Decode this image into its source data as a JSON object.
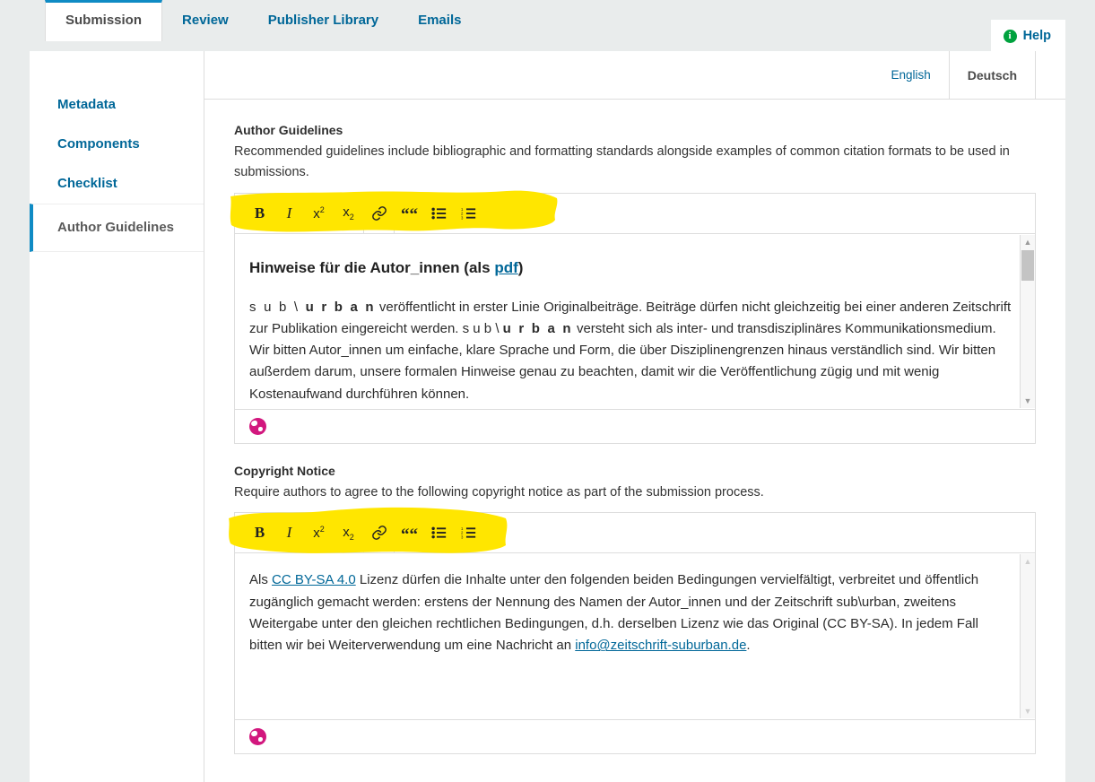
{
  "header": {
    "tabs": [
      {
        "label": "Submission",
        "active": true
      },
      {
        "label": "Review",
        "active": false
      },
      {
        "label": "Publisher Library",
        "active": false
      },
      {
        "label": "Emails",
        "active": false
      }
    ],
    "help_label": "Help",
    "help_icon": "info-icon"
  },
  "sidebar": {
    "items": [
      {
        "label": "Metadata",
        "active": false
      },
      {
        "label": "Components",
        "active": false
      },
      {
        "label": "Checklist",
        "active": false
      },
      {
        "label": "Author Guidelines",
        "active": true
      }
    ]
  },
  "language_tabs": [
    {
      "label": "English",
      "active": false
    },
    {
      "label": "Deutsch",
      "active": true
    }
  ],
  "toolbar": {
    "buttons": [
      {
        "name": "bold-button",
        "glyph": "B"
      },
      {
        "name": "italic-button",
        "glyph": "I"
      },
      {
        "name": "superscript-button",
        "glyph": "x",
        "script": "2"
      },
      {
        "name": "subscript-button",
        "glyph": "x",
        "script": "2"
      },
      {
        "name": "link-icon",
        "glyph": "link"
      },
      {
        "name": "blockquote-button",
        "glyph": "“"
      },
      {
        "name": "bullet-list-button",
        "glyph": "list"
      },
      {
        "name": "numbered-list-button",
        "glyph": "ordered-list"
      }
    ],
    "highlight_color": "#FFE600"
  },
  "fields": {
    "author_guidelines": {
      "label": "Author Guidelines",
      "description": "Recommended guidelines include bibliographic and formatting standards alongside examples of common citation formats to be used in submissions.",
      "heading_prefix": "Hinweise für die Autor_innen (als ",
      "heading_link": "pdf",
      "heading_suffix": ")",
      "body": {
        "l1a": "s u b \\ ",
        "l1b": "u r b a n",
        "l1c": " veröffentlicht in erster Linie Originalbeiträge. Beiträge dürfen nicht gleichzeitig bei einer anderen Zeitschrift zur Publikation eingereicht werden. s u b \\ ",
        "l2b": "u r b a n",
        "l2c": " versteht sich als inter- und transdisziplinäres Kommunikationsmedium. Wir bitten Autor_innen um einfache, klare Sprache und Form, die über Disziplinengrenzen hinaus verständlich sind. Wir bitten außerdem darum, unsere formalen Hinweise genau zu beachten, damit wir die Veröffentlichung zügig und mit wenig Kostenaufwand durchführen können."
      },
      "footer_icon": "globe-icon"
    },
    "copyright_notice": {
      "label": "Copyright Notice",
      "description": "Require authors to agree to the following copyright notice as part of the submission process.",
      "body": {
        "p1": "Als ",
        "link1": "CC BY-SA 4.0",
        "p2": " Lizenz dürfen die Inhalte unter den folgenden beiden Bedingungen vervielfältigt, verbreitet und öffentlich zugänglich gemacht werden: erstens der Nennung des Namen der Autor_innen und der Zeitschrift sub\\urban, zweitens Weitergabe unter den gleichen rechtlichen Bedingungen, d.h. derselben Lizenz wie das Original (CC BY-SA). In jedem Fall bitten wir bei Weiterverwendung um eine Nachricht an ",
        "link2": "info@zeitschrift-suburban.de",
        "p3": "."
      },
      "footer_icon": "globe-icon"
    }
  },
  "scrollbar": {
    "up_glyph": "▲",
    "down_glyph": "▼"
  }
}
